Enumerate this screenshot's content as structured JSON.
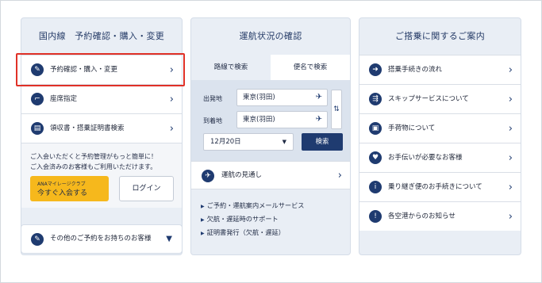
{
  "domestic": {
    "heading": "国内線　予約確認・購入・変更",
    "items": [
      {
        "label": "予約確認・購入・変更",
        "icon": "edit-icon",
        "glyph": "✎"
      },
      {
        "label": "座席指定",
        "icon": "seat-icon",
        "glyph": "⌐"
      },
      {
        "label": "領収書・搭乗証明書検索",
        "icon": "receipt-icon",
        "glyph": "▤"
      }
    ],
    "promo_line1": "ご入会いただくと予約管理がもっと簡単に！",
    "promo_line2": "ご入会済みのお客様もご利用いただけます。",
    "join_small": "ANAマイレージクラブ",
    "join_main": "今すぐ入会する",
    "login": "ログイン",
    "other_label": "その他のご予約をお持ちのお客様"
  },
  "status": {
    "heading": "運航状況の確認",
    "tab_route": "路線で検索",
    "tab_flight": "便名で検索",
    "dep_label": "出発地",
    "dep_value": "東京(羽田)",
    "arr_label": "到着地",
    "arr_value": "東京(羽田)",
    "date": "12月20日",
    "search": "検索",
    "forecast": "運航の見通し",
    "links": [
      "ご予約・運航案内メールサービス",
      "欠航・遅延時のサポート",
      "証明書発行（欠航・遅延）"
    ]
  },
  "boarding": {
    "heading": "ご搭乗に関するご案内",
    "items": [
      {
        "label": "搭乗手続きの流れ",
        "icon": "arrow-right-icon",
        "glyph": "➜"
      },
      {
        "label": "スキップサービスについて",
        "icon": "skip-icon",
        "glyph": "⇶"
      },
      {
        "label": "手荷物について",
        "icon": "luggage-icon",
        "glyph": "▣"
      },
      {
        "label": "お手伝いが必要なお客様",
        "icon": "heart-icon",
        "glyph": "♥"
      },
      {
        "label": "乗り継ぎ便のお手続きについて",
        "icon": "info-icon",
        "glyph": "i"
      },
      {
        "label": "各空港からのお知らせ",
        "icon": "exclamation-icon",
        "glyph": "!"
      }
    ]
  },
  "colors": {
    "navy": "#1f3b70",
    "join": "#f6b81c",
    "highlight": "#e03127",
    "panel": "#e9eef5"
  }
}
